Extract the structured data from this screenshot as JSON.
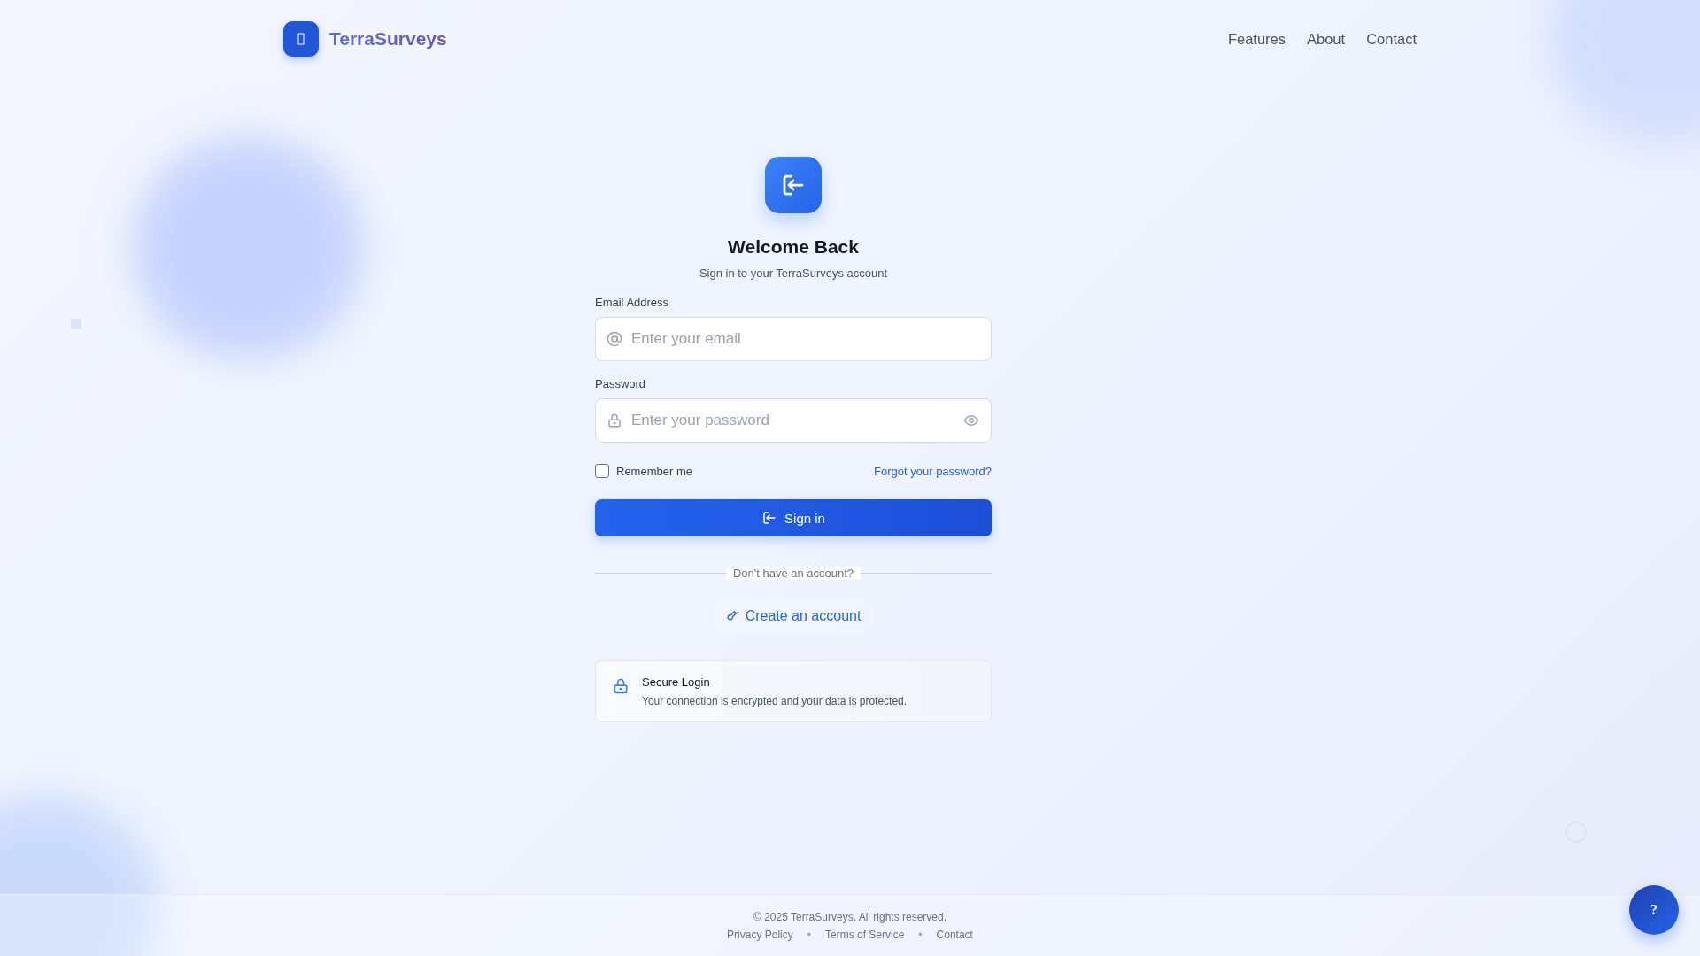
{
  "header": {
    "brand": "TerraSurveys",
    "nav": [
      "Features",
      "About",
      "Contact"
    ]
  },
  "login": {
    "title": "Welcome Back",
    "subtitle": "Sign in to your TerraSurveys account",
    "fields": [
      {
        "kind": "email",
        "label": "Email Address",
        "placeholder": "Enter your email"
      },
      {
        "kind": "password",
        "label": "Password",
        "placeholder": "Enter your password"
      }
    ],
    "remember": {
      "label": "Remember me",
      "checked": false
    },
    "forgot": "Forgot your password?",
    "submit": "Sign in",
    "divider": "Don't have an account?",
    "create": "Create an account",
    "notice": {
      "title": "Secure Login",
      "text": "Your connection is encrypted and your data is protected."
    }
  },
  "footer": {
    "copyright": "© 2025 TerraSurveys. All rights reserved.",
    "separator": "•",
    "links": [
      "Privacy Policy",
      "Terms of Service",
      "Contact"
    ]
  },
  "help": "?"
}
